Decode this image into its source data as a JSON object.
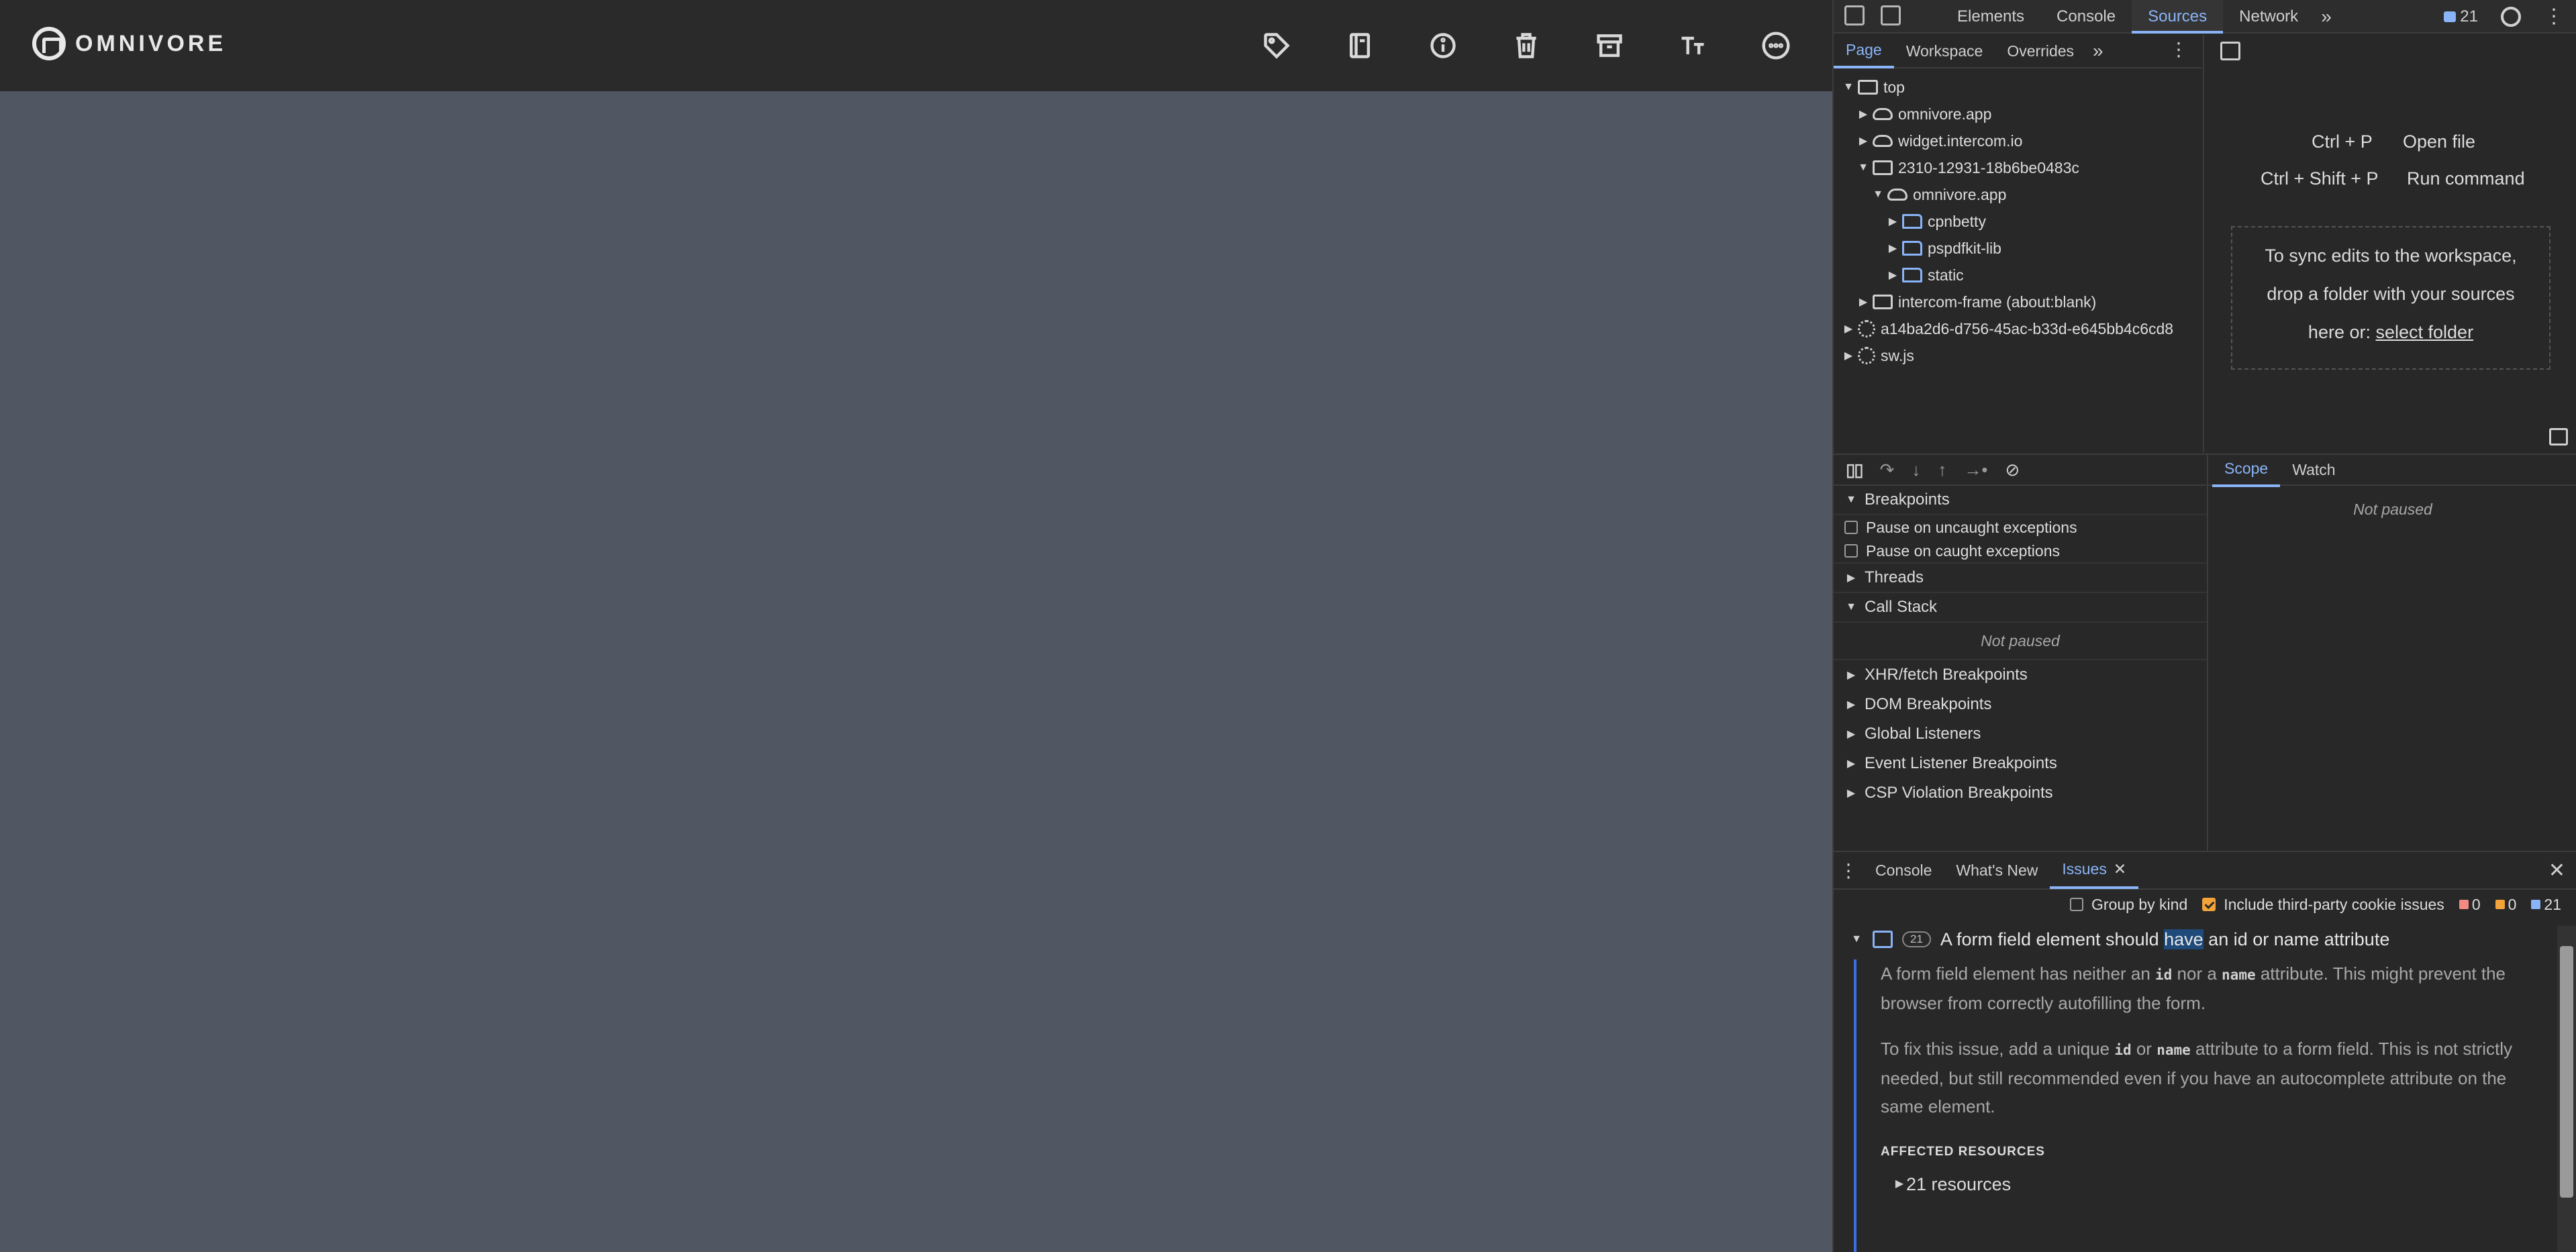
{
  "app": {
    "logo_text": "OMNIVORE",
    "toolbar": [
      {
        "name": "tag-icon"
      },
      {
        "name": "notebook-icon"
      },
      {
        "name": "info-icon"
      },
      {
        "name": "trash-icon"
      },
      {
        "name": "archive-icon"
      },
      {
        "name": "text-size-icon"
      },
      {
        "name": "more-options-icon"
      }
    ]
  },
  "devtools": {
    "main_tabs": [
      "Elements",
      "Console",
      "Sources",
      "Network"
    ],
    "active_main_tab": "Sources",
    "issues_count": "21",
    "navigator_tabs": [
      "Page",
      "Workspace",
      "Overrides"
    ],
    "active_navigator_tab": "Page",
    "tree": [
      {
        "label": "top",
        "icon": "frame-icon",
        "expanded": true,
        "depth": 0
      },
      {
        "label": "omnivore.app",
        "icon": "cloud-icon",
        "expanded": false,
        "depth": 1
      },
      {
        "label": "widget.intercom.io",
        "icon": "cloud-icon",
        "expanded": false,
        "depth": 1
      },
      {
        "label": "2310-12931-18b6be0483c",
        "icon": "frame-icon",
        "expanded": true,
        "depth": 1
      },
      {
        "label": "omnivore.app",
        "icon": "cloud-icon",
        "expanded": true,
        "depth": 2
      },
      {
        "label": "cpnbetty",
        "icon": "folder-icon",
        "expanded": false,
        "depth": 3
      },
      {
        "label": "pspdfkit-lib",
        "icon": "folder-icon",
        "expanded": false,
        "depth": 3
      },
      {
        "label": "static",
        "icon": "folder-icon",
        "expanded": false,
        "depth": 3
      },
      {
        "label": "intercom-frame (about:blank)",
        "icon": "frame-icon",
        "expanded": false,
        "depth": 1
      },
      {
        "label": "a14ba2d6-d756-45ac-b33d-e645bb4c6cd8",
        "icon": "gear-icon",
        "expanded": false,
        "depth": 0
      },
      {
        "label": "sw.js",
        "icon": "gear-icon",
        "expanded": false,
        "depth": 0
      }
    ],
    "editor": {
      "open_file_keys": "Ctrl + P",
      "open_file_label": "Open file",
      "run_command_keys": "Ctrl + Shift + P",
      "run_command_label": "Run command",
      "sync_line1": "To sync edits to the workspace,",
      "sync_line2": "drop a folder with your sources",
      "sync_line3": "here or: ",
      "sync_link": "select folder"
    },
    "debugger": {
      "breakpoints_label": "Breakpoints",
      "pause_uncaught": "Pause on uncaught exceptions",
      "pause_caught": "Pause on caught exceptions",
      "threads_label": "Threads",
      "callstack_label": "Call Stack",
      "not_paused": "Not paused",
      "sections": [
        "XHR/fetch Breakpoints",
        "DOM Breakpoints",
        "Global Listeners",
        "Event Listener Breakpoints",
        "CSP Violation Breakpoints"
      ],
      "right_tabs": [
        "Scope",
        "Watch"
      ],
      "right_not_paused": "Not paused"
    },
    "drawer": {
      "tabs": [
        "Console",
        "What's New",
        "Issues"
      ],
      "active_tab": "Issues",
      "group_by_kind": "Group by kind",
      "include_third_party": "Include third-party cookie issues",
      "errors": "0",
      "warnings": "0",
      "infos": "21",
      "issue": {
        "count": "21",
        "title_before": "A form field element should ",
        "title_highlight": "have",
        "title_after": " an id or name attribute",
        "p1_a": "A form field element has neither an ",
        "p1_code1": "id",
        "p1_b": " nor a ",
        "p1_code2": "name",
        "p1_c": " attribute. This might prevent the browser from correctly autofilling the form.",
        "p2_a": "To fix this issue, add a unique ",
        "p2_code1": "id",
        "p2_b": " or ",
        "p2_code2": "name",
        "p2_c": " attribute to a form field. This is not strictly needed, but still recommended even if you have an autocomplete attribute on the same element.",
        "affected": "AFFECTED RESOURCES",
        "resources": "21 resources"
      }
    },
    "colors": {
      "accent": "#8ab4f8",
      "error": "#f28b82",
      "warning": "#f2a33a"
    }
  }
}
